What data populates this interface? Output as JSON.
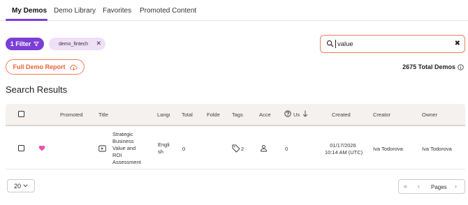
{
  "tabs": [
    {
      "label": "My Demos",
      "active": true
    },
    {
      "label": "Demo Library",
      "active": false
    },
    {
      "label": "Favorites",
      "active": false
    },
    {
      "label": "Promoted Content",
      "active": false
    }
  ],
  "filters": {
    "filter_button_label": "1 Filter",
    "chip_label": "demo_fintech"
  },
  "search": {
    "value": "value",
    "placeholder": ""
  },
  "report_button_label": "Full Demo Report",
  "total_label": "2675 Total Demos",
  "section_title": "Search Results",
  "table": {
    "headers": {
      "promoted": "Promoted",
      "title": "Title",
      "language": "Langu",
      "total": "Total",
      "folder": "Folde",
      "tags": "Tags",
      "access": "Acce",
      "uses": "Us",
      "created": "Created",
      "creator": "Creator",
      "owner": "Owner"
    },
    "rows": [
      {
        "favorite": true,
        "title_lines": [
          "Strategic",
          "Business",
          "Value and",
          "ROI",
          "Assessment"
        ],
        "language_lines": [
          "Engli",
          "sh"
        ],
        "total": "0",
        "tags_count": "2",
        "uses": "0",
        "created_date": "01/17/2026",
        "created_time": "10:14 AM (UTC)",
        "creator": "Iva Todorova",
        "owner": "Iva Todorova"
      }
    ]
  },
  "pagination": {
    "page_size": "20",
    "pages_label": "Pages"
  },
  "colors": {
    "accent_purple": "#7b3fd6",
    "accent_orange": "#ef7d5a",
    "chip_bg": "#efdff7",
    "heart": "#e94fb0"
  }
}
